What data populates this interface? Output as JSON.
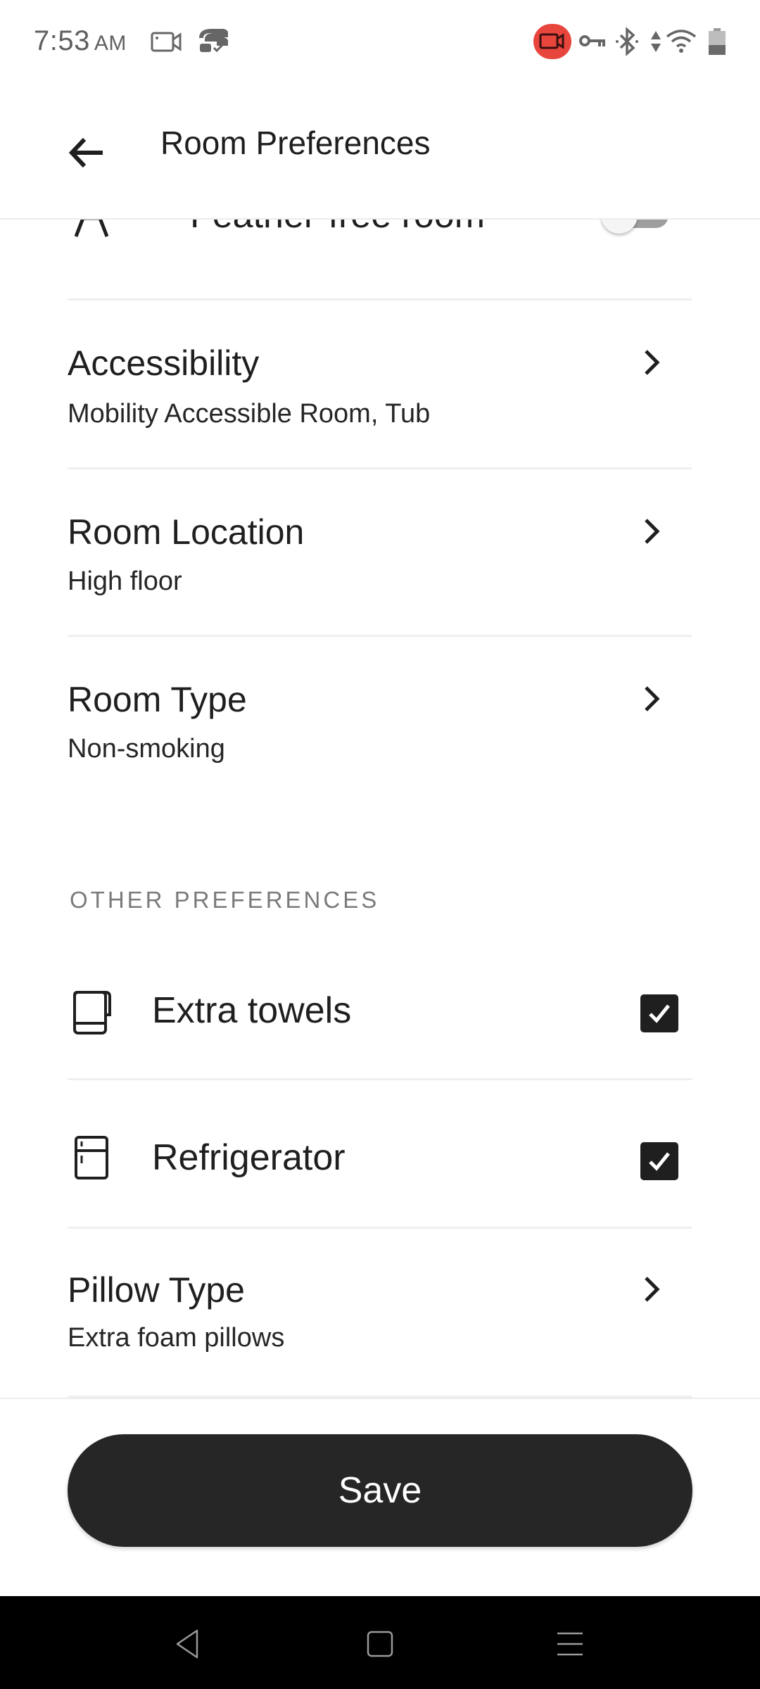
{
  "status_bar": {
    "time": "7:53",
    "ampm": "AM",
    "left_icons": [
      "screen-record-icon",
      "vpn-app-icon"
    ],
    "right_icons": [
      "recording-indicator-icon",
      "vpn-key-icon",
      "bluetooth-icon",
      "data-arrows-icon",
      "wifi-icon",
      "battery-icon"
    ],
    "recording_color": "#e8453c"
  },
  "header": {
    "title": "Room Preferences",
    "back_icon": "arrow-left-icon"
  },
  "partial_row": {
    "label": "Feather-free room",
    "icon": "feather-free-icon",
    "toggle_on": false
  },
  "rows": [
    {
      "title": "Accessibility",
      "subtitle": "Mobility Accessible Room, Tub"
    },
    {
      "title": "Room Location",
      "subtitle": "High floor"
    },
    {
      "title": "Room Type",
      "subtitle": "Non-smoking"
    }
  ],
  "other_preferences": {
    "section_label": "OTHER PREFERENCES",
    "checks": [
      {
        "label": "Extra towels",
        "icon": "towel-icon",
        "checked": true
      },
      {
        "label": "Refrigerator",
        "icon": "refrigerator-icon",
        "checked": true
      }
    ],
    "pillow": {
      "title": "Pillow Type",
      "subtitle": "Extra foam pillows"
    }
  },
  "footer": {
    "save_label": "Save"
  },
  "nav": {
    "icons": [
      "nav-back-icon",
      "nav-home-icon",
      "nav-menu-icon"
    ]
  }
}
